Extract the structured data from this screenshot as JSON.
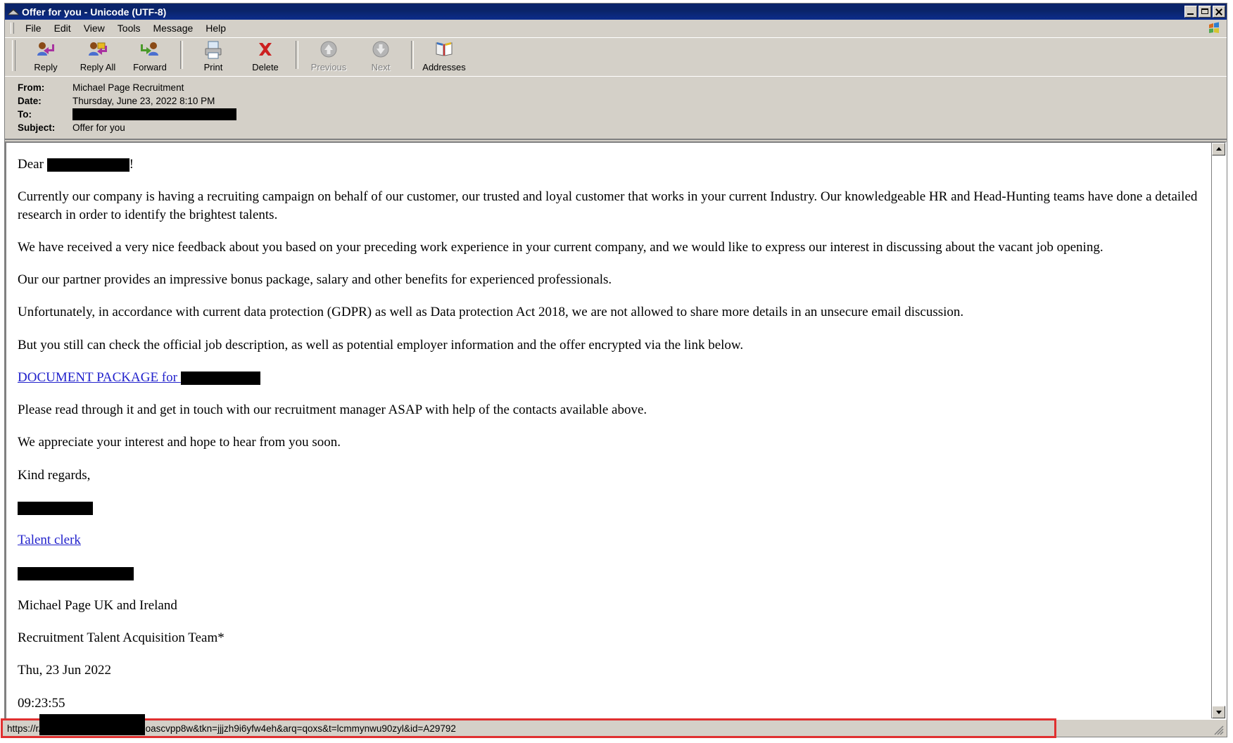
{
  "window": {
    "title": "Offer for you - Unicode (UTF-8)",
    "icon": "envelope-icon",
    "minimize_label": "Minimize",
    "maximize_label": "Maximize",
    "close_label": "Close"
  },
  "menu": {
    "items": [
      {
        "label": "File"
      },
      {
        "label": "Edit"
      },
      {
        "label": "View"
      },
      {
        "label": "Tools"
      },
      {
        "label": "Message"
      },
      {
        "label": "Help"
      }
    ]
  },
  "toolbar": {
    "buttons": [
      {
        "label": "Reply",
        "icon": "reply-icon",
        "disabled": false
      },
      {
        "label": "Reply All",
        "icon": "reply-all-icon",
        "disabled": false
      },
      {
        "label": "Forward",
        "icon": "forward-icon",
        "disabled": false
      },
      {
        "label": "Print",
        "icon": "printer-icon",
        "disabled": false
      },
      {
        "label": "Delete",
        "icon": "delete-x-icon",
        "disabled": false
      },
      {
        "label": "Previous",
        "icon": "arrow-up-circle-icon",
        "disabled": true
      },
      {
        "label": "Next",
        "icon": "arrow-down-circle-icon",
        "disabled": true
      },
      {
        "label": "Addresses",
        "icon": "address-book-icon",
        "disabled": false
      }
    ]
  },
  "headers": {
    "from_label": "From:",
    "from_value": "Michael Page Recruitment",
    "date_label": "Date:",
    "date_value": "Thursday, June 23, 2022 8:10 PM",
    "to_label": "To:",
    "to_value": "",
    "subject_label": "Subject:",
    "subject_value": "Offer for you"
  },
  "message": {
    "greeting_prefix": "Dear ",
    "greeting_suffix": "!",
    "paragraphs": [
      "Currently our company is having a recruiting campaign on behalf of our customer, our trusted and loyal customer that works in your current Industry. Our knowledgeable HR and Head-Hunting teams have done a detailed research in order to identify the brightest talents.",
      "We have received a very nice feedback about you based on your preceding work experience in your current company, and we would like to express our interest in discussing about the vacant job opening.",
      "Our our partner provides an impressive bonus package, salary and other benefits for experienced professionals.",
      "Unfortunately, in accordance with current data protection (GDPR) as well as Data protection Act 2018, we are not allowed to share more details in an unsecure email discussion.",
      "But you still can check the official job description, as well as potential employer information and the offer encrypted via the link below."
    ],
    "document_link_text": "DOCUMENT PACKAGE for ",
    "after_link_paragraphs": [
      "Please read through it and get in touch with our recruitment manager ASAP with help of the contacts available above.",
      "We appreciate your interest and hope to hear from you soon."
    ],
    "signature": {
      "closing": "Kind regards,",
      "name_redacted": "",
      "role_link": "Talent clerk",
      "contact_redacted": "",
      "lines": [
        "Michael Page UK and Ireland",
        "Recruitment Talent Acquisition Team*",
        "Thu, 23 Jun 2022",
        "09:23:55"
      ]
    }
  },
  "status": {
    "url_prefix": "https://r",
    "url_suffix": "/mp/?source=en0&open=oascvpp8w&tkn=jjjzh9i6yfw4eh&arq=qoxs&t=lcmmynwu90zyl&id=A29792",
    "highlight_color": "#e03030"
  }
}
